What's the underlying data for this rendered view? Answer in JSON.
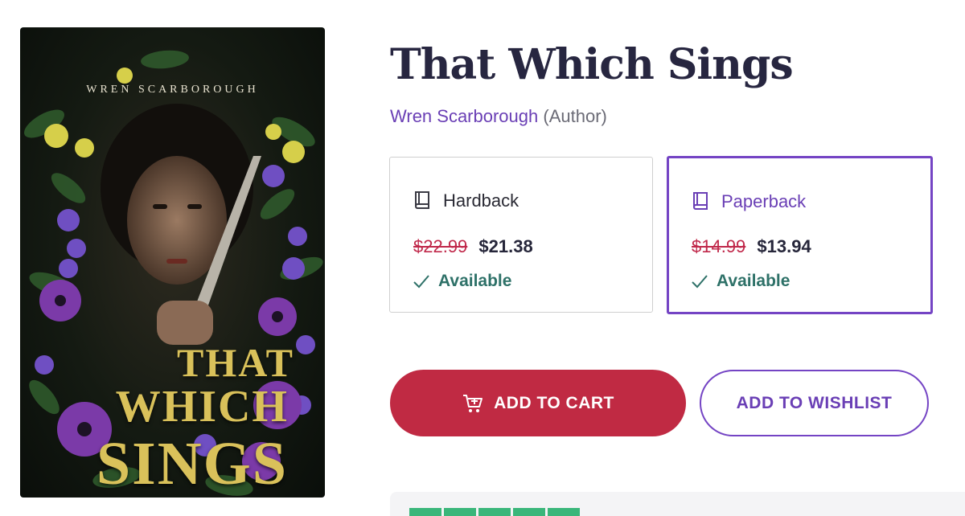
{
  "book": {
    "title": "That Which Sings",
    "author": "Wren Scarborough",
    "author_role": "(Author)",
    "cover": {
      "author_text": "WREN SCARBOROUGH",
      "title_lines": [
        "THAT",
        "WHICH",
        "SINGS"
      ]
    }
  },
  "formats": [
    {
      "name": "Hardback",
      "icon": "book-icon",
      "old_price": "$22.99",
      "price": "$21.38",
      "availability": "Available",
      "selected": false
    },
    {
      "name": "Paperback",
      "icon": "book-icon",
      "old_price": "$14.99",
      "price": "$13.94",
      "availability": "Available",
      "selected": true
    }
  ],
  "actions": {
    "add_to_cart": "ADD TO CART",
    "add_to_wishlist": "ADD TO WISHLIST"
  },
  "colors": {
    "accent_purple": "#6a3fb5",
    "cart_red": "#c02a43",
    "sale_red": "#c0284a",
    "available_green": "#2e7168",
    "rating_green": "#3ab67a"
  }
}
